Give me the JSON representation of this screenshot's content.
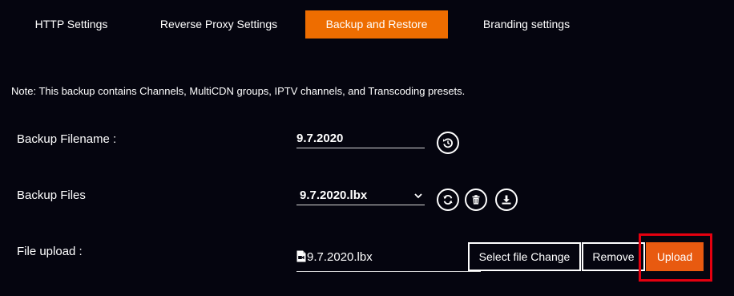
{
  "tabs": [
    {
      "label": "HTTP Settings",
      "active": false
    },
    {
      "label": "Reverse Proxy Settings",
      "active": false
    },
    {
      "label": "Backup and Restore",
      "active": true
    },
    {
      "label": "Branding settings",
      "active": false
    }
  ],
  "note": "Note: This backup contains Channels, MultiCDN groups, IPTV channels, and Transcoding presets.",
  "backup_filename": {
    "label": "Backup Filename :",
    "value": "9.7.2020",
    "icon": "restore-icon"
  },
  "backup_files": {
    "label": "Backup Files",
    "selected": "9.7.2020.lbx",
    "icons": [
      "refresh-icon",
      "trash-icon",
      "download-icon"
    ]
  },
  "file_upload": {
    "label": "File upload :",
    "file_name": "9.7.2020.lbx",
    "select_change_label": "Select file Change",
    "remove_label": "Remove",
    "upload_label": "Upload"
  },
  "colors": {
    "background": "#05050f",
    "accent": "#ee6d00",
    "upload": "#e85a10",
    "highlight": "#e5000f"
  }
}
